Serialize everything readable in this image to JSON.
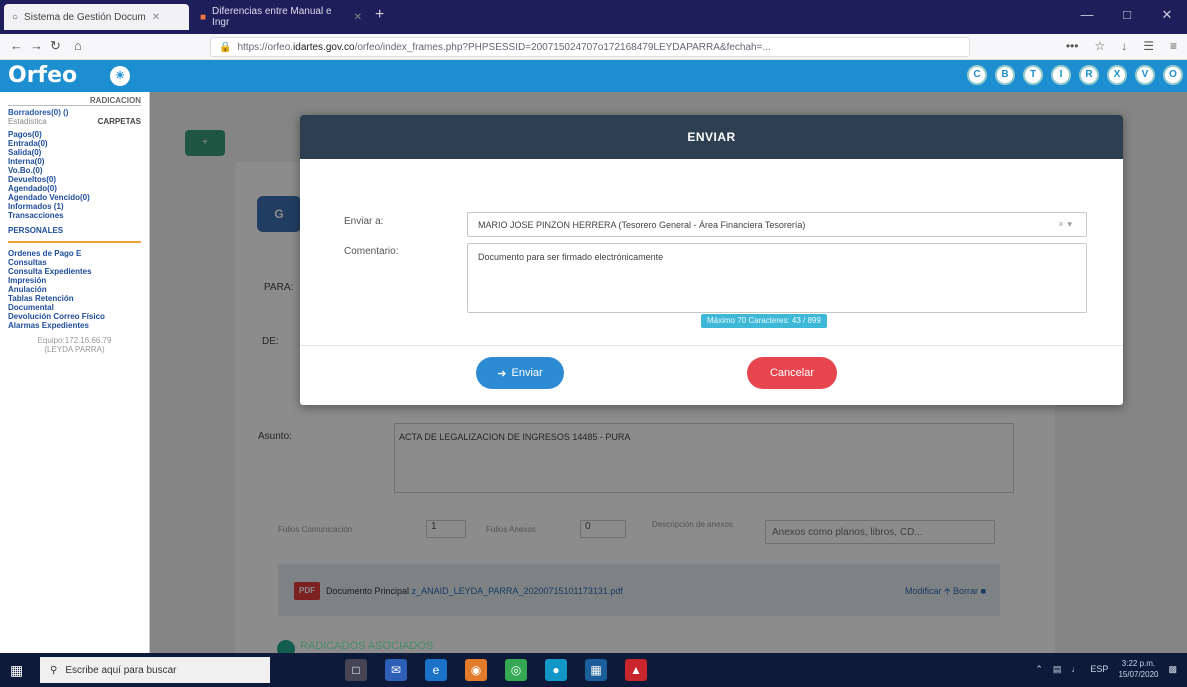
{
  "browser": {
    "tabs": [
      {
        "label": "Sistema de Gestión Docum"
      },
      {
        "label": "Diferencias entre Manual e Ingr"
      }
    ],
    "url_prefix": "https://orfeo.",
    "url_domain": "idartes.gov.co",
    "url_rest": "/orfeo/index_frames.php?PHPSESSID=200715024707o172168479LEYDAPARRA&fechah=...",
    "menu_dots": "•••"
  },
  "app": {
    "logo": "Orfeo",
    "topbar_icons": [
      "C",
      "B",
      "T",
      "I",
      "R",
      "X",
      "V",
      "O"
    ]
  },
  "sidebar": {
    "heading": "RADICACION",
    "user": "Borradores(0) ()",
    "left_label": "Estadistica",
    "carpetas": "CARPETAS",
    "items": [
      "Pagos(0)",
      "Entrada(0)",
      "Salida(0)",
      "Interna(0)",
      "Vo.Bo.(0)",
      "Devueltos(0)",
      "Agendado(0)",
      "Agendado Vencido(0)",
      "Informados (1)",
      "Transacciones"
    ],
    "personales": "PERSONALES",
    "items2": [
      "Ordenes de Pago E",
      "Consultas",
      "Consulta Expedientes",
      "Impresión",
      "Anulación",
      "Tablas Retención",
      "Documental",
      "Devolución Correo Físico",
      "Alarmas Expedientes"
    ],
    "ip": "Equipo:172.16.66.79",
    "ip2": "(LEYDA PARRA)"
  },
  "page": {
    "para_label": "PARA:",
    "de_label": "DE:",
    "asunto_label": "Asunto:",
    "asunto_value": "ACTA DE LEGALIZACION DE INGRESOS 14485 - PURA",
    "folios_label": "Folios Comunicación",
    "folios_value": "1",
    "anexos_label": "Folios Anexos",
    "anexos_value": "0",
    "desc_label": "Descripción de anexos",
    "anexos_placeholder": "Anexos como planos, libros, CD...",
    "doc_label": "Documento Principal",
    "doc_link": "z_ANAID_LEYDA_PARRA_20200715101173131.pdf",
    "modificar": "Modificar",
    "borrar": "Borrar",
    "radicados": "RADICADOS ASOCIADOS",
    "ba_btn": "G",
    "green_btn": "+"
  },
  "modal": {
    "title": "ENVIAR",
    "enviar_a_label": "Enviar a:",
    "enviar_a_value": "MARIO JOSE PINZON HERRERA (Tesorero General - Área Financiera Tesorería)",
    "comentario_label": "Comentario:",
    "comentario_value": "Documento para ser firmado electrónicamente",
    "counter": "Máximo 70 Caracteres: 43 / 899",
    "send_label": "Enviar",
    "cancel_label": "Cancelar"
  },
  "taskbar": {
    "search_placeholder": "Escribe aquí para buscar",
    "lang": "ESP",
    "time": "3:22 p.m.",
    "date": "15/07/2020"
  }
}
